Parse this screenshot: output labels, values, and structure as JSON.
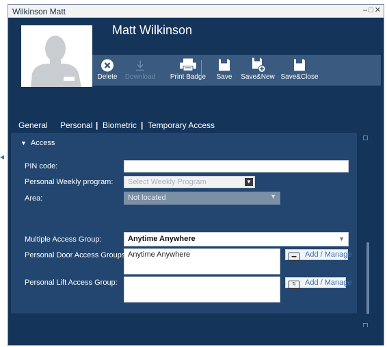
{
  "window": {
    "title": "Wilkinson Matt",
    "controls": [
      "minimize-icon",
      "maximize-icon",
      "close-icon"
    ]
  },
  "profile": {
    "name": "Matt Wilkinson",
    "photo_icon": "person-silhouette-icon"
  },
  "toolbar": {
    "buttons": [
      {
        "label": "Delete",
        "icon": "delete-circle-icon",
        "enabled": true
      },
      {
        "label": "Download",
        "icon": "download-arrow-icon",
        "enabled": false
      },
      {
        "label": "Print Badge",
        "icon": "printer-icon",
        "enabled": true
      },
      {
        "label": "Save",
        "icon": "floppy-disk-icon",
        "enabled": true
      },
      {
        "label": "Save&New",
        "icon": "floppy-disk-plus-icon",
        "enabled": true
      },
      {
        "label": "Save&Close",
        "icon": "floppy-disk-icon",
        "enabled": true
      }
    ]
  },
  "tabs": [
    {
      "label": "General",
      "active": true
    },
    {
      "label": "Personal",
      "active": false
    },
    {
      "label": "Biometric",
      "active": false
    },
    {
      "label": "Temporary Access",
      "active": false
    }
  ],
  "tab_separator": "|",
  "access": {
    "section_title": "Access",
    "section_icon": "triangle-down-icon",
    "pin": {
      "label": "PIN code:",
      "value": ""
    },
    "weekly_program": {
      "label": "Personal Weekly program:",
      "placeholder": "Select Weekly Program"
    },
    "area": {
      "label": "Area:",
      "value": "Not located"
    },
    "multiple_access_group": {
      "label": "Multiple Access Group:",
      "value": "Anytime Anywhere"
    },
    "door_access_groups": {
      "label": "Personal Door Access Groups:",
      "value": "Anytime Anywhere",
      "button": "Add / Manage",
      "button_icon": "card-reader-icon"
    },
    "lift_access_group": {
      "label": "Personal Lift Access Group:",
      "value": "",
      "button": "Add / Manage",
      "button_icon": "lift-icon"
    }
  },
  "colors": {
    "window_bg": "#14345a",
    "toolbar_bg": "#3a5a80",
    "content_bg": "#22466f",
    "link_blue": "#3a6fb0"
  }
}
